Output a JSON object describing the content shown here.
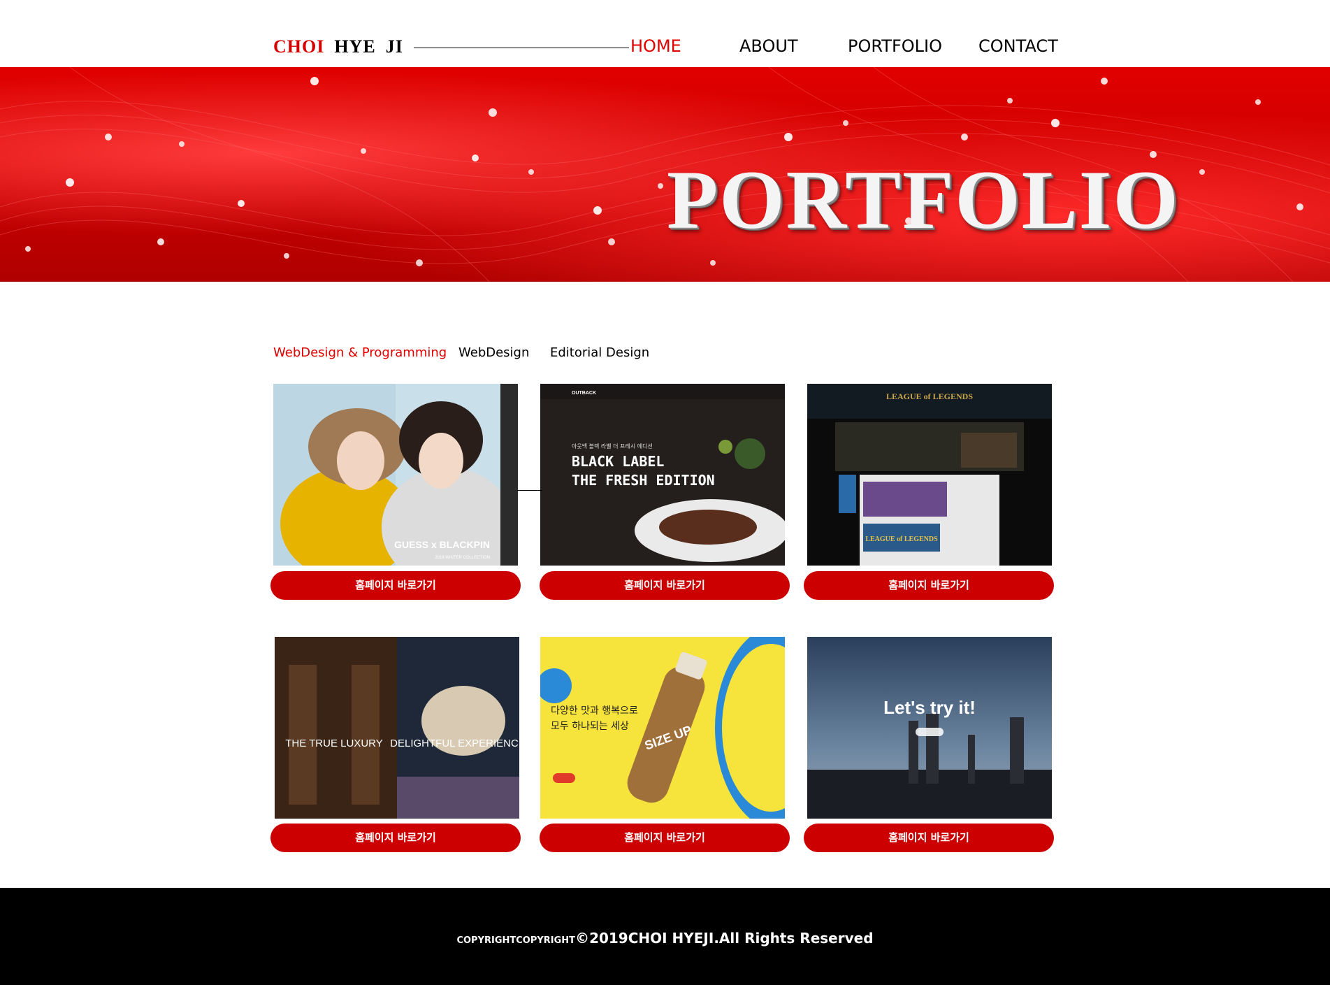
{
  "header": {
    "logo": {
      "part1": "CHOI",
      "part2": "HYE",
      "part3": "JI"
    },
    "nav": [
      {
        "label": "HOME",
        "active": true
      },
      {
        "label": "ABOUT",
        "active": false
      },
      {
        "label": "PORTFOLIO",
        "active": false
      },
      {
        "label": "CONTACT",
        "active": false
      }
    ]
  },
  "hero": {
    "title": "PORTFOLIO"
  },
  "tabs": [
    {
      "label": "WebDesign & Programming",
      "active": true
    },
    {
      "label": "WebDesign",
      "active": false
    },
    {
      "label": "Editorial Design",
      "active": false
    }
  ],
  "projects": [
    {
      "thumb_text": [
        "GUESS x BLACKPIN",
        "2018 WINTER COLLECTION"
      ],
      "button": "홈페이지 바로가기"
    },
    {
      "thumb_text": [
        "OUTBACK",
        "아웃백 블랙 라벨 더 프레시 에디션",
        "BLACK LABEL",
        "THE FRESH EDITION"
      ],
      "button": "홈페이지 바로가기"
    },
    {
      "thumb_text": [
        "LEAGUE of LEGENDS",
        "LEAGUE of LEGENDS"
      ],
      "button": "홈페이지 바로가기"
    },
    {
      "thumb_text": [
        "THE TRUE LUXURY",
        "DELIGHTFUL EXPERIENCE"
      ],
      "button": "홈페이지 바로가기"
    },
    {
      "thumb_text": [
        "다양한 맛과 행복으로",
        "모두 하나되는 세상",
        "SIZE UP"
      ],
      "button": "홈페이지 바로가기"
    },
    {
      "thumb_text": [
        "Let's try it!"
      ],
      "button": "홈페이지 바로가기"
    }
  ],
  "footer": {
    "copyright_small": "COPYRIGHTCOPYRIGHT",
    "copyright_main": "©2019CHOI HYEJI.All Rights Reserved"
  },
  "colors": {
    "accent": "#cc0000",
    "hero_red": "#d40000",
    "footer_bg": "#000000"
  }
}
